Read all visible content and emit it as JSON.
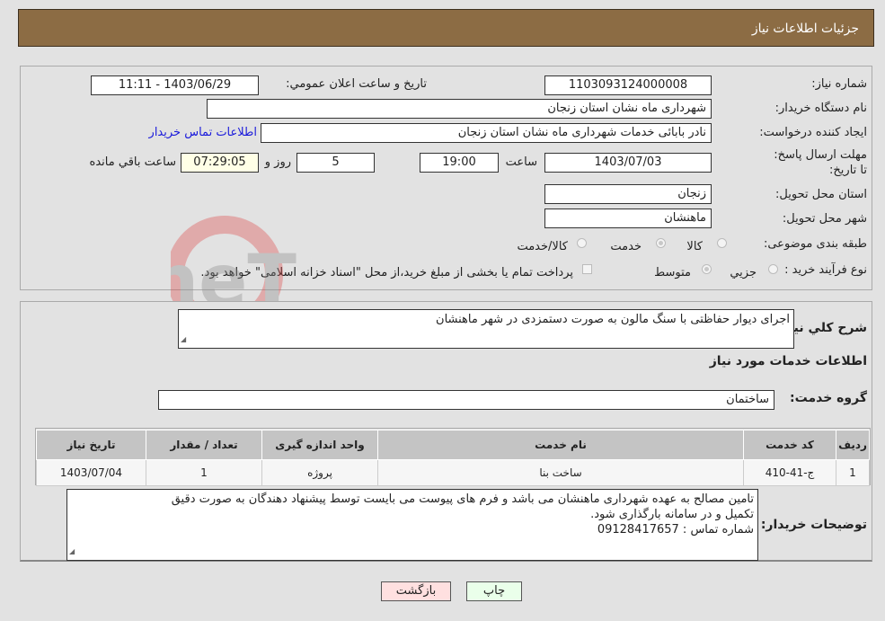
{
  "header": {
    "title": "جزئیات اطلاعات نیاز"
  },
  "details": {
    "need_number_label": "شماره نیاز:",
    "need_number": "1103093124000008",
    "announce_label": "تاریخ و ساعت اعلان عمومي:",
    "announce_value": "1403/06/29 - 11:11",
    "buyer_org_label": "نام دستگاه خریدار:",
    "buyer_org": "شهرداری ماه نشان استان زنجان",
    "creator_label": "ایجاد کننده درخواست:",
    "creator": "نادر  بابائی خدمات شهرداری ماه نشان استان زنجان",
    "contact_link": "اطلاعات تماس خریدار",
    "deadline_label": "مهلت ارسال پاسخ: تا تاریخ:",
    "deadline_date": "1403/07/03",
    "time_label": "ساعت",
    "deadline_time": "19:00",
    "days_value": "5",
    "days_label": "روز و",
    "remaining_time": "07:29:05",
    "remaining_label": "ساعت باقي مانده",
    "province_label": "استان محل تحویل:",
    "province": "زنجان",
    "city_label": "شهر محل تحویل:",
    "city": "ماهنشان",
    "category_label": "طبقه بندی موضوعی:",
    "category_options": [
      {
        "label": "کالا",
        "selected": false
      },
      {
        "label": "خدمت",
        "selected": true
      },
      {
        "label": "کالا/خدمت",
        "selected": false
      }
    ],
    "process_label": "نوع فرآیند خرید :",
    "process_options": [
      {
        "label": "جزيي",
        "selected": false
      },
      {
        "label": "متوسط",
        "selected": true
      }
    ],
    "treasury_checkbox_label": "پرداخت تمام یا بخشی از مبلغ خرید،از محل \"اسناد خزانه اسلامی\" خواهد بود.",
    "treasury_checked": false
  },
  "services": {
    "description_label": "شرح کلي نیاز:",
    "description": "اجرای دیوار حفاظتی با سنگ مالون به صورت دستمزدی در شهر ماهنشان",
    "section_title": "اطلاعات خدمات مورد نیاز",
    "group_label": "گروه خدمت:",
    "group_value": "ساختمان",
    "table": {
      "headers": [
        "ردیف",
        "کد خدمت",
        "نام خدمت",
        "واحد اندازه گیری",
        "تعداد / مقدار",
        "تاریخ نیاز"
      ],
      "rows": [
        [
          "1",
          "ج-41-410",
          "ساخت بنا",
          "پروژه",
          "1",
          "1403/07/04"
        ]
      ]
    },
    "buyer_notes_label": "توضیحات خریدار:",
    "buyer_notes_lines": [
      "تامین مصالح به عهده شهرداری ماهنشان می باشد و فرم های پیوست می بایست توسط پیشنهاد دهندگان به صورت دقیق",
      "تکمیل و در سامانه بارگذاری شود.",
      "شماره تماس : 09128417657"
    ]
  },
  "buttons": {
    "print": "چاپ",
    "back": "بازگشت"
  },
  "colors": {
    "header_bg": "#8c6c44",
    "print_bg": "#eaffea",
    "back_bg": "#ffe0e0",
    "link": "#1a1adb"
  }
}
